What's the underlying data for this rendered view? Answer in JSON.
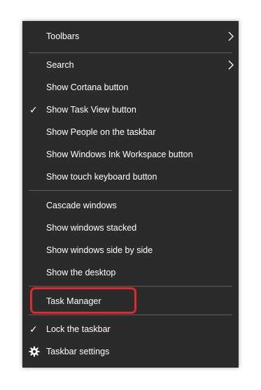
{
  "menu": {
    "toolbars": "Toolbars",
    "search": "Search",
    "show_cortana": "Show Cortana button",
    "show_task_view": "Show Task View button",
    "show_people": "Show People on the taskbar",
    "show_ink": "Show Windows Ink Workspace button",
    "show_touch_keyboard": "Show touch keyboard button",
    "cascade": "Cascade windows",
    "stacked": "Show windows stacked",
    "side_by_side": "Show windows side by side",
    "show_desktop": "Show the desktop",
    "task_manager": "Task Manager",
    "lock_taskbar": "Lock the taskbar",
    "taskbar_settings": "Taskbar settings"
  },
  "icons": {
    "check": "✓",
    "submenu": "chevron-right-icon",
    "settings": "gear-icon"
  },
  "colors": {
    "menu_background": "#2b2b2b",
    "highlight_outline": "#e0282e"
  },
  "state": {
    "show_task_view_checked": true,
    "lock_taskbar_checked": true,
    "highlighted_item": "Task Manager"
  }
}
